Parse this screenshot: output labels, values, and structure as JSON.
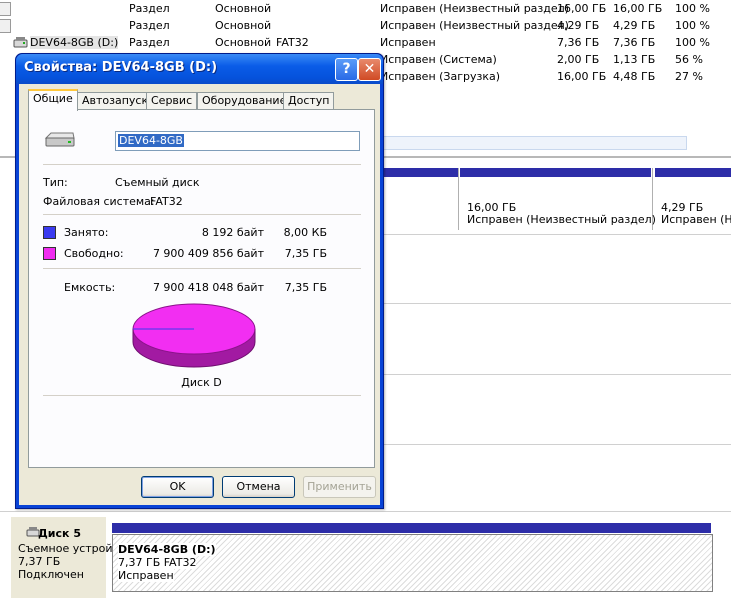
{
  "volume_rows": [
    {
      "name": "",
      "layout": "Раздел",
      "type": "Основной",
      "fs": "",
      "status": "Исправен (Неизвестный раздел)",
      "capacity": "16,00 ГБ",
      "free": "16,00 ГБ",
      "pct": "100 %"
    },
    {
      "name": "",
      "layout": "Раздел",
      "type": "Основной",
      "fs": "",
      "status": "Исправен (Неизвестный раздел)",
      "capacity": "4,29 ГБ",
      "free": "4,29 ГБ",
      "pct": "100 %"
    },
    {
      "name": "DEV64-8GB (D:)",
      "layout": "Раздел",
      "type": "Основной",
      "fs": "FAT32",
      "status": "Исправен",
      "capacity": "7,36 ГБ",
      "free": "7,36 ГБ",
      "pct": "100 %"
    },
    {
      "name": "",
      "layout": "",
      "type": "",
      "fs": "",
      "status": "Исправен (Система)",
      "capacity": "2,00 ГБ",
      "free": "1,13 ГБ",
      "pct": "56 %"
    },
    {
      "name": "",
      "layout": "",
      "type": "",
      "fs": "",
      "status": "Исправен (Загрузка)",
      "capacity": "16,00 ГБ",
      "free": "4,48 ГБ",
      "pct": "27 %"
    }
  ],
  "graph": {
    "part1_size": "16,00 ГБ",
    "part1_status": "Исправен (Неизвестный раздел)",
    "part2_size": "4,29 ГБ",
    "part2_status": "Исправен (Неи"
  },
  "disk5": {
    "title": "Диск 5",
    "type": "Съемное устрой",
    "size": "7,37 ГБ",
    "state": "Подключен",
    "vol_name": "DEV64-8GB (D:)",
    "vol_size": "7,37 ГБ FAT32",
    "vol_status": "Исправен"
  },
  "dialog": {
    "title": "Свойства: DEV64-8GB (D:)",
    "help_glyph": "?",
    "close_glyph": "✕",
    "tabs": [
      "Общие",
      "Автозапуск",
      "Сервис",
      "Оборудование",
      "Доступ"
    ],
    "label_value": "DEV64-8GB",
    "type_label": "Тип:",
    "type_value": "Съемный диск",
    "fs_label": "Файловая система:",
    "fs_value": "FAT32",
    "used_label": "Занято:",
    "used_bytes": "8 192 байт",
    "used_short": "8,00 КБ",
    "free_label": "Свободно:",
    "free_bytes": "7 900 409 856 байт",
    "free_short": "7,35 ГБ",
    "cap_label": "Емкость:",
    "cap_bytes": "7 900 418 048 байт",
    "cap_short": "7,35 ГБ",
    "disk_caption": "Диск D",
    "ok": "OK",
    "cancel": "Отмена",
    "apply": "Применить",
    "used_color": "#3b3bf0",
    "free_color": "#f02cf0"
  }
}
